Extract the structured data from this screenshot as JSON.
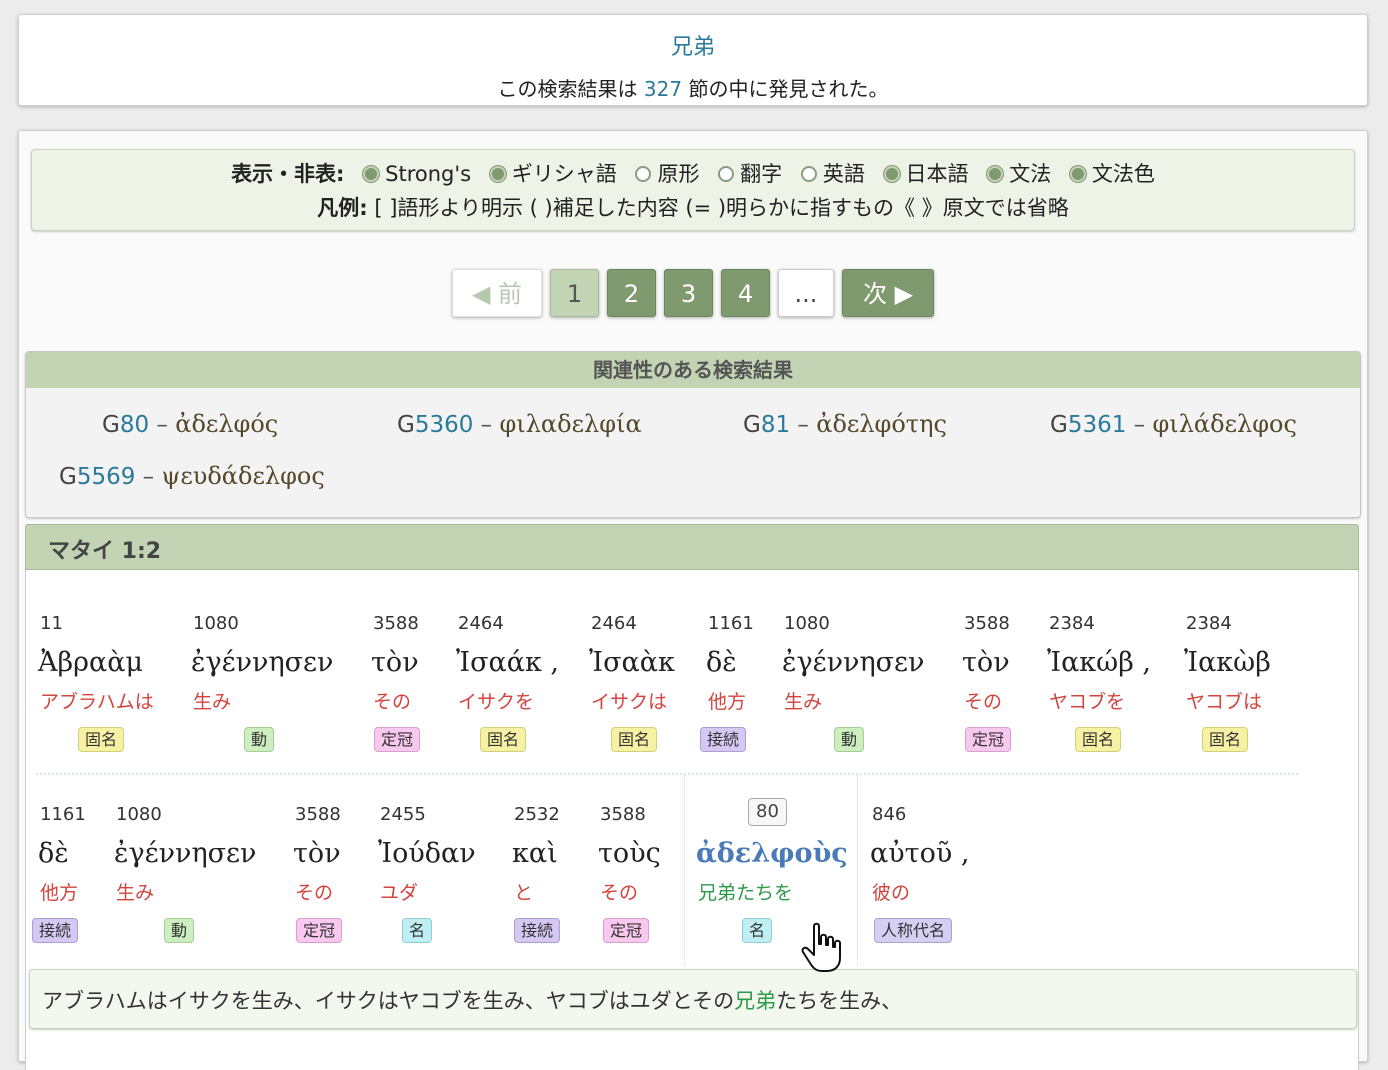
{
  "search": {
    "query": "兄弟",
    "result_prefix": "この検索結果は ",
    "result_count": "327",
    "result_suffix": " 節の中に発見された。"
  },
  "options": {
    "label": "表示・非表:",
    "toggles": [
      {
        "label": "Strong's",
        "on": true
      },
      {
        "label": "ギリシャ語",
        "on": true
      },
      {
        "label": "原形",
        "on": false
      },
      {
        "label": "翻字",
        "on": false
      },
      {
        "label": "英語",
        "on": false
      },
      {
        "label": "日本語",
        "on": true
      },
      {
        "label": "文法",
        "on": true
      },
      {
        "label": "文法色",
        "on": true
      }
    ],
    "legend_label": "凡例:",
    "legend_text": "[ ]語形より明示 ( )補足した内容 (= )明らかに指すもの《 》原文では省略"
  },
  "pager": {
    "prev": "◀ 前",
    "pages": [
      "1",
      "2",
      "3",
      "4"
    ],
    "current": "1",
    "dots": "...",
    "next": "次 ▶"
  },
  "related": {
    "title": "関連性のある検索結果",
    "items": [
      {
        "g": "G",
        "num": "80",
        "sep": " – ",
        "word": "ἀδελφός"
      },
      {
        "g": "G",
        "num": "5360",
        "sep": " – ",
        "word": "φιλαδελφία"
      },
      {
        "g": "G",
        "num": "81",
        "sep": " – ",
        "word": "ἀδελφότης"
      },
      {
        "g": "G",
        "num": "5361",
        "sep": " – ",
        "word": "φιλάδελφος"
      },
      {
        "g": "G",
        "num": "5569",
        "sep": " – ",
        "word": "ψευδάδελφος"
      }
    ]
  },
  "verse": {
    "reference": "マタイ 1:2",
    "words": [
      {
        "strong": "11",
        "greek": "Ἀβραὰμ",
        "jp": "アブラハムは",
        "tag": "固名"
      },
      {
        "strong": "1080",
        "greek": "ἐγέννησεν",
        "jp": "生み",
        "tag": "動"
      },
      {
        "strong": "3588",
        "greek": "τὸν",
        "jp": "その",
        "tag": "定冠"
      },
      {
        "strong": "2464",
        "greek": "Ἰσαάκ ,",
        "jp": "イサクを",
        "tag": "固名"
      },
      {
        "strong": "2464",
        "greek": "Ἰσαὰκ",
        "jp": "イサクは",
        "tag": "固名"
      },
      {
        "strong": "1161",
        "greek": "δὲ",
        "jp": "他方",
        "tag": "接続"
      },
      {
        "strong": "1080",
        "greek": "ἐγέννησεν",
        "jp": "生み",
        "tag": "動"
      },
      {
        "strong": "3588",
        "greek": "τὸν",
        "jp": "その",
        "tag": "定冠"
      },
      {
        "strong": "2384",
        "greek": "Ἰακώβ ,",
        "jp": "ヤコブを",
        "tag": "固名"
      },
      {
        "strong": "2384",
        "greek": "Ἰακὼβ",
        "jp": "ヤコブは",
        "tag": "固名"
      },
      {
        "strong": "1161",
        "greek": "δὲ",
        "jp": "他方",
        "tag": "接続"
      },
      {
        "strong": "1080",
        "greek": "ἐγέννησεν",
        "jp": "生み",
        "tag": "動"
      },
      {
        "strong": "3588",
        "greek": "τὸν",
        "jp": "その",
        "tag": "定冠"
      },
      {
        "strong": "2455",
        "greek": "Ἰούδαν",
        "jp": "ユダ",
        "tag": "名"
      },
      {
        "strong": "2532",
        "greek": "καὶ",
        "jp": "と",
        "tag": "接続"
      },
      {
        "strong": "3588",
        "greek": "τοὺς",
        "jp": "その",
        "tag": "定冠"
      },
      {
        "strong": "80",
        "greek": "ἀδελφοὺς",
        "jp": "兄弟たちを",
        "tag": "名"
      },
      {
        "strong": "846",
        "greek": "αὐτοῦ ,",
        "jp": "彼の",
        "tag": "人称代名"
      }
    ],
    "translation_before": "アブラハムはイサクを生み、イサクはヤコブを生み、ヤコブはユダとその",
    "translation_highlight": "兄弟",
    "translation_after": "たちを生み、"
  },
  "colors": {
    "accent_green": "#7f9a6f",
    "link_blue": "#2b7a9b",
    "gloss_red": "#d2443d",
    "highlight_green": "#2e9a4a"
  }
}
